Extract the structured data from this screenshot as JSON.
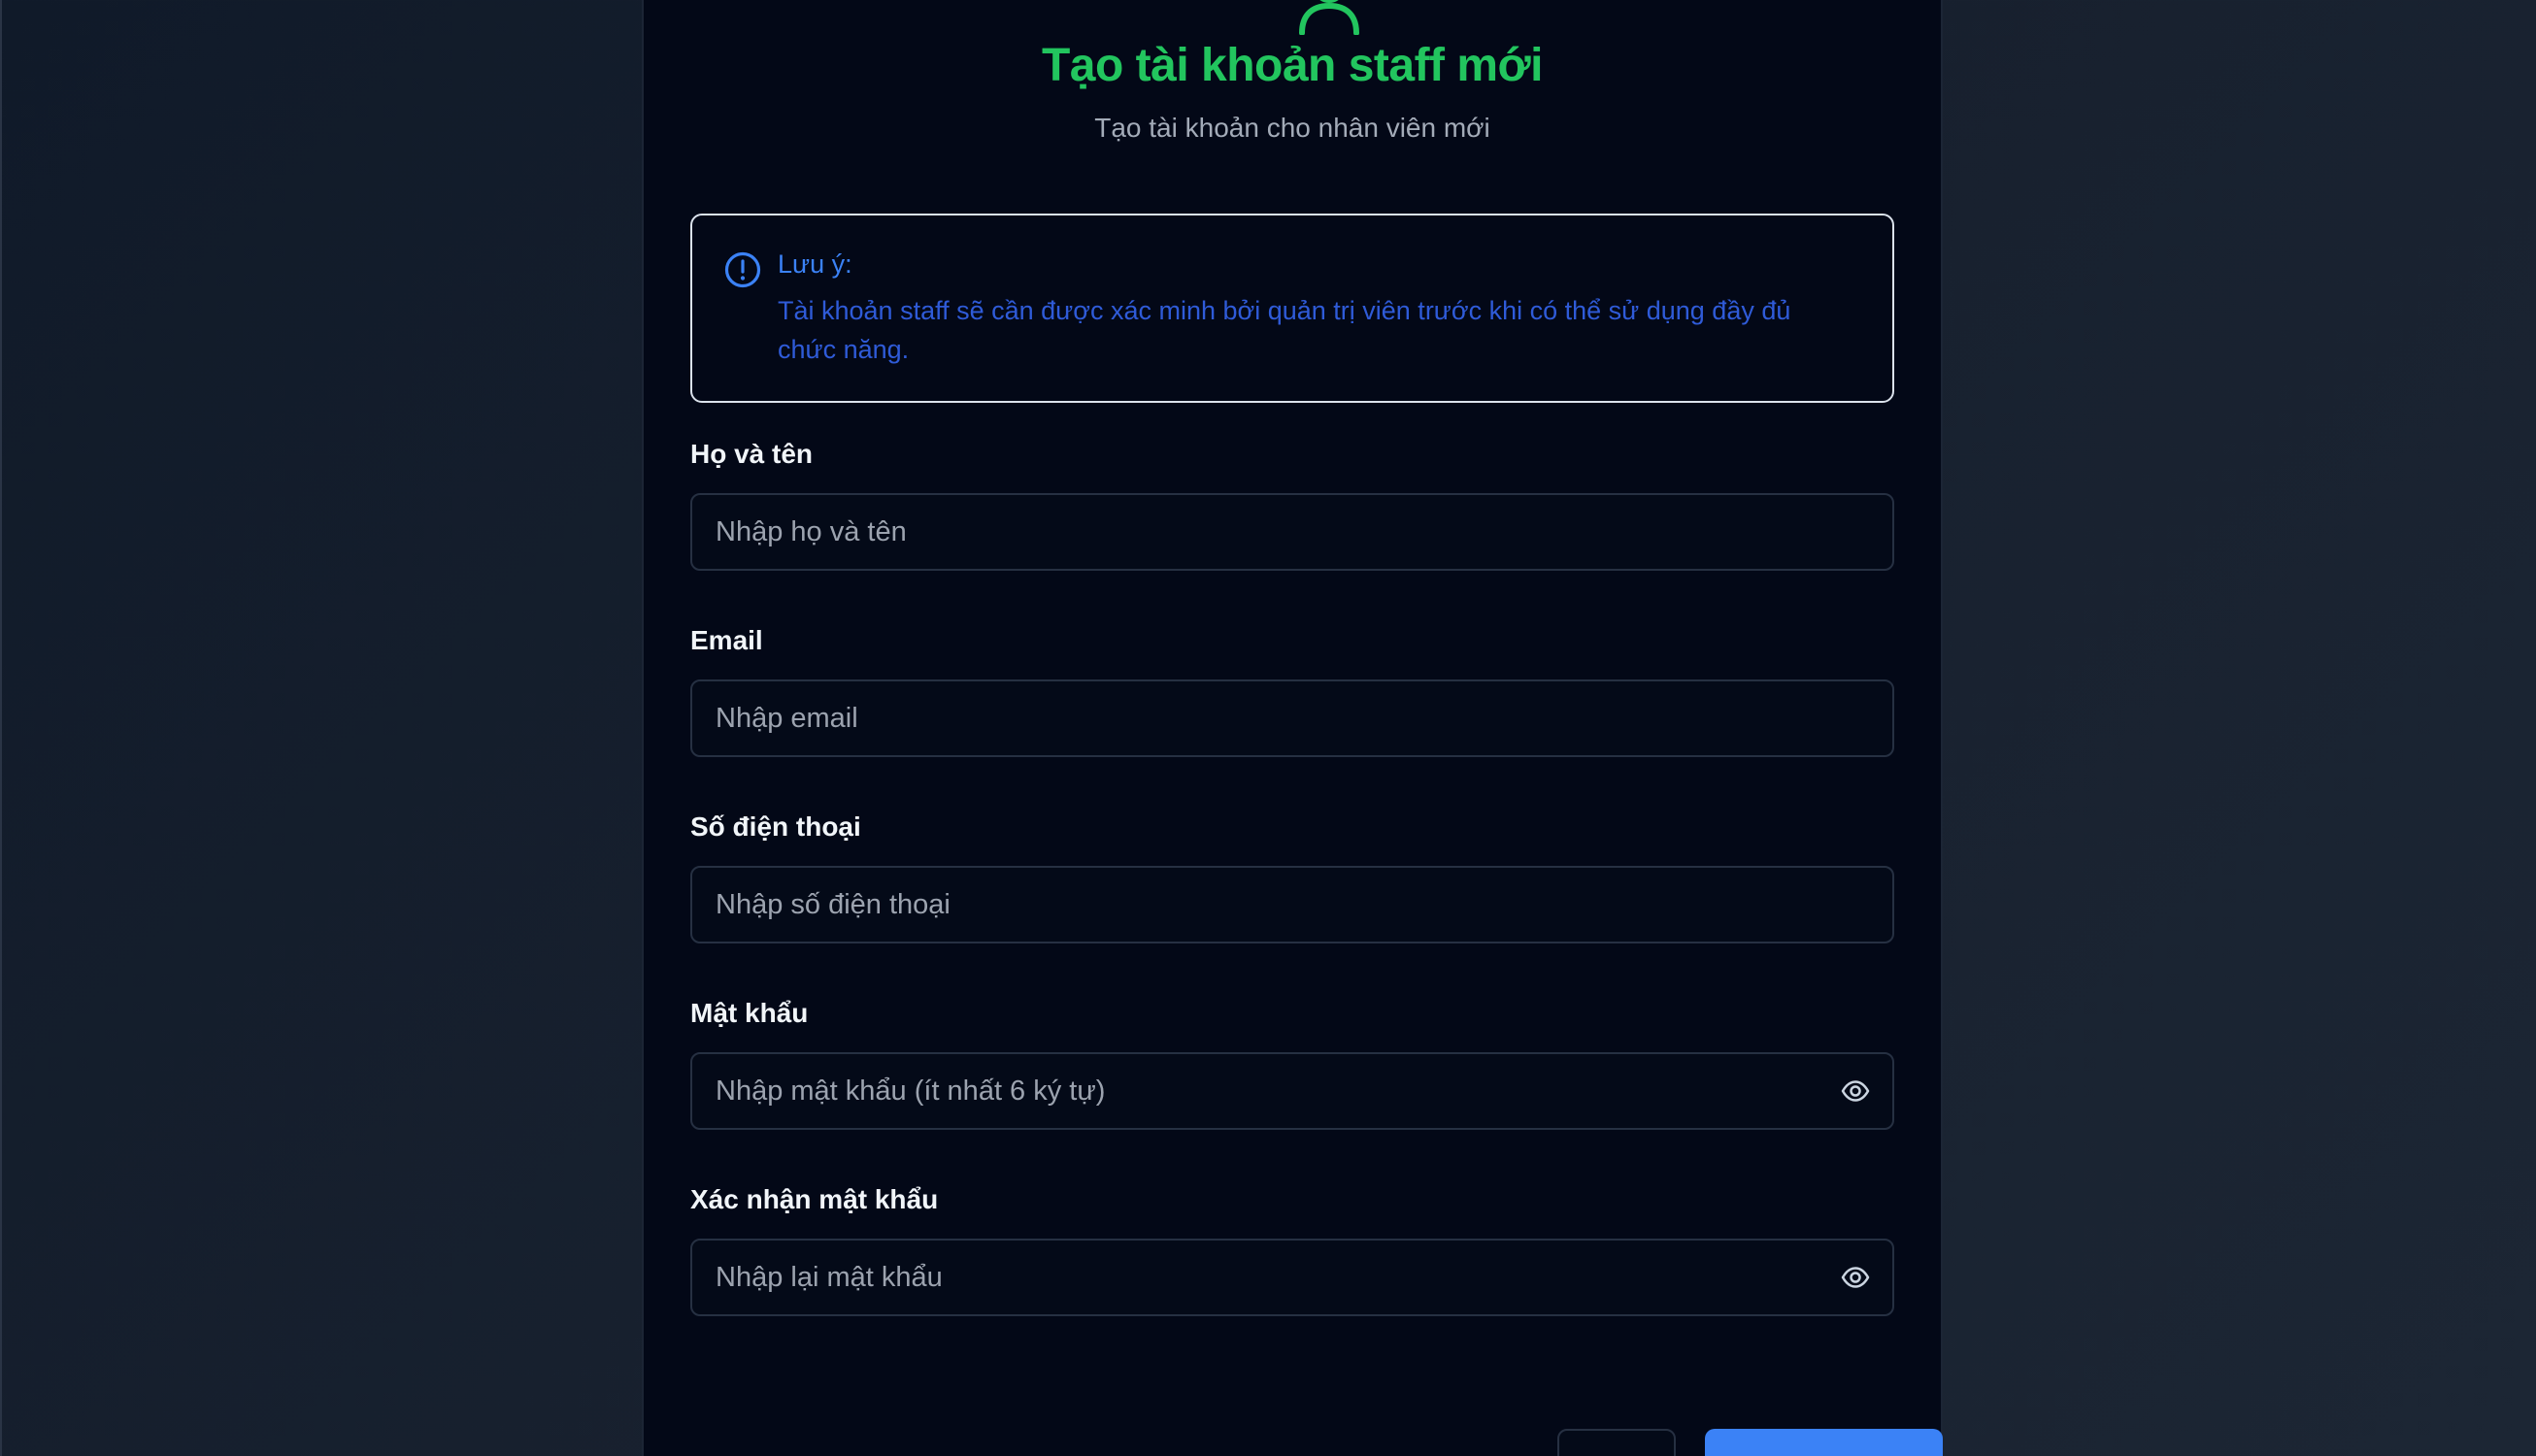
{
  "form": {
    "title": "Tạo tài khoản staff mới",
    "subtitle": "Tạo tài khoản cho nhân viên mới",
    "header_icon": "user-plus-icon",
    "notice": {
      "icon": "alert-circle-icon",
      "title": "Lưu ý:",
      "text": "Tài khoản staff sẽ cần được xác minh bởi quản trị viên trước khi có thể sử dụng đầy đủ chức năng."
    },
    "fields": {
      "full_name": {
        "label": "Họ và tên",
        "placeholder": "Nhập họ và tên",
        "value": ""
      },
      "email": {
        "label": "Email",
        "placeholder": "Nhập email",
        "value": ""
      },
      "phone": {
        "label": "Số điện thoại",
        "placeholder": "Nhập số điện thoại",
        "value": ""
      },
      "password": {
        "label": "Mật khẩu",
        "placeholder": "Nhập mật khẩu (ít nhất 6 ký tự)",
        "value": "",
        "toggle_icon": "eye-icon"
      },
      "confirm_password": {
        "label": "Xác nhận mật khẩu",
        "placeholder": "Nhập lại mật khẩu",
        "value": "",
        "toggle_icon": "eye-icon"
      }
    },
    "buttons": {
      "secondary_label": "",
      "primary_label": ""
    }
  },
  "colors": {
    "title": "#22c55e",
    "accent": "#3b82f6",
    "notice_text": "#2f5bd8",
    "modal_bg": "#030817",
    "input_border": "#263042"
  }
}
